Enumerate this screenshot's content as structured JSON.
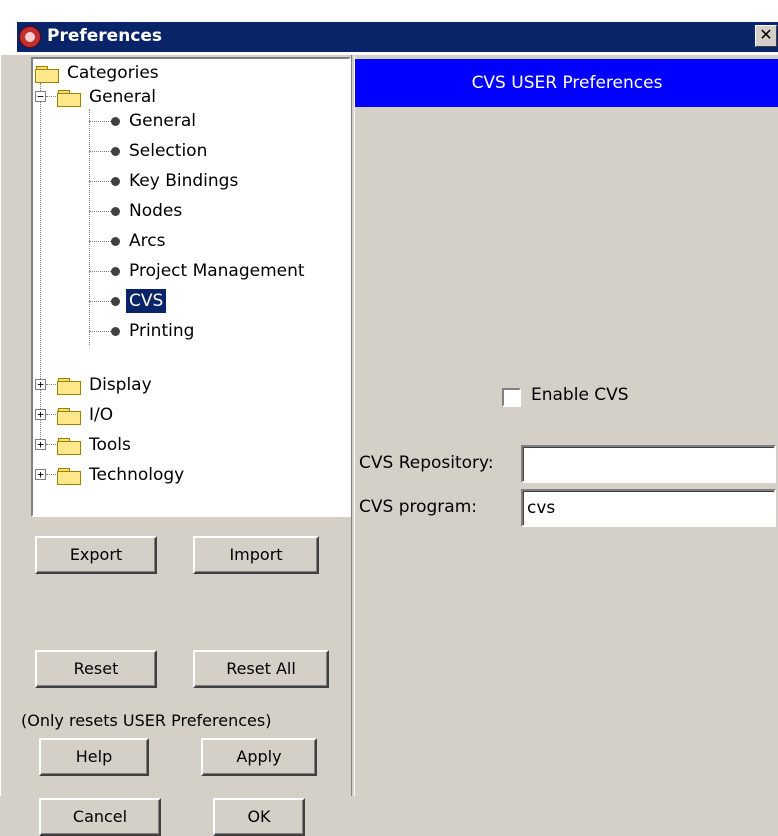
{
  "window": {
    "title": "Preferences",
    "close_glyph": "✕",
    "title_icon": "electric-logo-icon"
  },
  "tree": {
    "root_label": "Categories",
    "expanded": {
      "label": "General",
      "toggle": "−",
      "children": [
        "General",
        "Selection",
        "Key Bindings",
        "Nodes",
        "Arcs",
        "Project Management",
        "CVS",
        "Printing"
      ],
      "selected": "CVS"
    },
    "collapsed": [
      {
        "label": "Display",
        "toggle": "+"
      },
      {
        "label": "I/O",
        "toggle": "+"
      },
      {
        "label": "Tools",
        "toggle": "+"
      },
      {
        "label": "Technology",
        "toggle": "+"
      }
    ]
  },
  "buttons": {
    "export": "Export",
    "import": "Import",
    "reset": "Reset",
    "reset_all": "Reset All",
    "reset_note": "(Only resets USER Preferences)",
    "help": "Help",
    "apply": "Apply",
    "cancel": "Cancel",
    "ok": "OK"
  },
  "panel": {
    "header": "CVS USER Preferences",
    "enable_cvs": {
      "label": "Enable CVS",
      "checked": false
    },
    "repository": {
      "label": "CVS Repository:",
      "value": ""
    },
    "program": {
      "label": "CVS program:",
      "value": "cvs"
    }
  },
  "colors": {
    "header_bg": "#0000ff",
    "title_bg": "#0a246a",
    "selection_bg": "#0a246a",
    "face": "#d4d0c8"
  }
}
